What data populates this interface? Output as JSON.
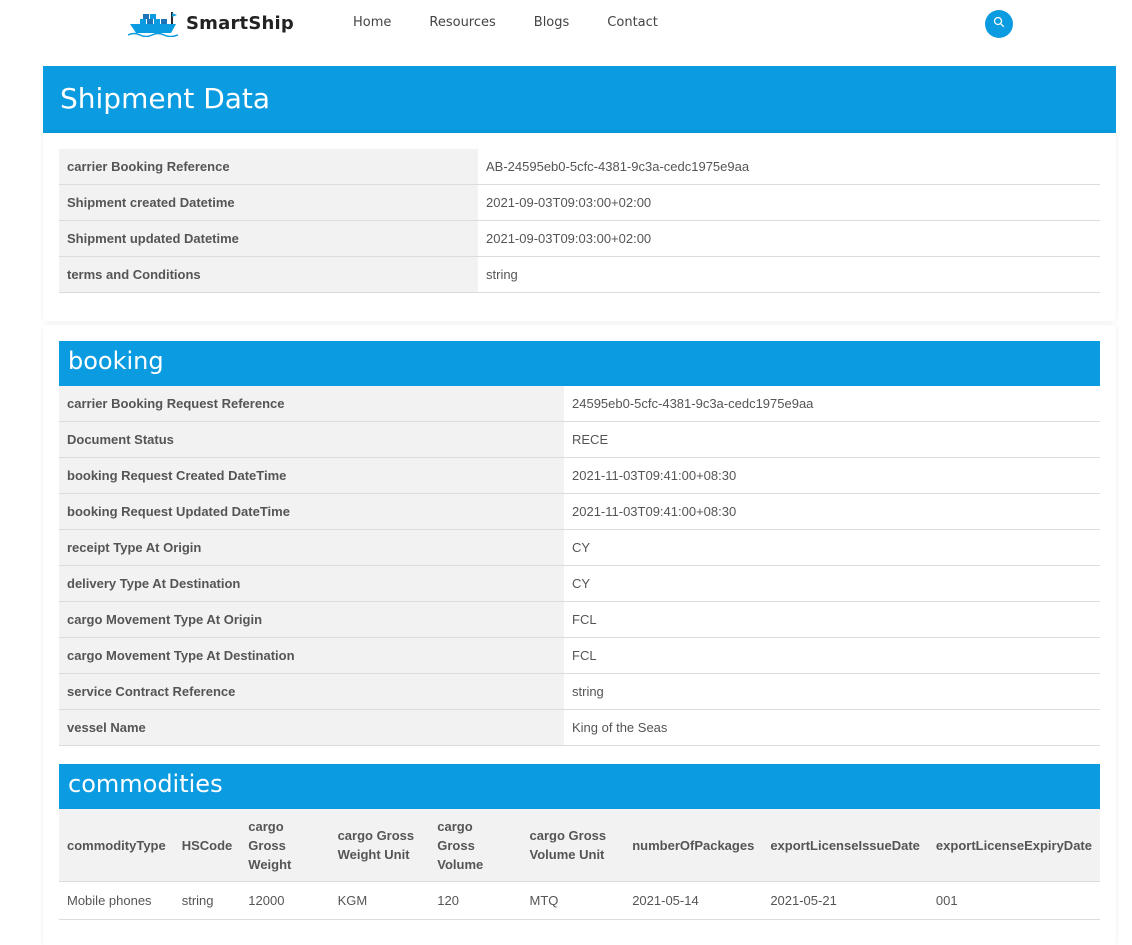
{
  "brand": {
    "name": "SmartShip",
    "logo_icon": "cargo-ship-icon"
  },
  "nav": [
    "Home",
    "Resources",
    "Blogs",
    "Contact"
  ],
  "search_icon": "search-icon",
  "colors": {
    "accent": "#0b9be0",
    "label_bg": "#f2f2f2"
  },
  "page_title": "Shipment Data",
  "shipment": [
    {
      "label": "carrier Booking Reference",
      "value": "AB-24595eb0-5cfc-4381-9c3a-cedc1975e9aa"
    },
    {
      "label": "Shipment created Datetime",
      "value": "2021-09-03T09:03:00+02:00"
    },
    {
      "label": "Shipment updated Datetime",
      "value": "2021-09-03T09:03:00+02:00"
    },
    {
      "label": "terms and Conditions",
      "value": "string"
    }
  ],
  "booking": {
    "title": "booking",
    "rows": [
      {
        "label": "carrier Booking Request Reference",
        "value": "24595eb0-5cfc-4381-9c3a-cedc1975e9aa"
      },
      {
        "label": "Document Status",
        "value": "RECE"
      },
      {
        "label": "booking Request Created DateTime",
        "value": "2021-11-03T09:41:00+08:30"
      },
      {
        "label": "booking Request Updated DateTime",
        "value": "2021-11-03T09:41:00+08:30"
      },
      {
        "label": "receipt Type At Origin",
        "value": "CY"
      },
      {
        "label": "delivery Type At Destination",
        "value": "CY"
      },
      {
        "label": "cargo Movement Type At Origin",
        "value": "FCL"
      },
      {
        "label": "cargo Movement Type At Destination",
        "value": "FCL"
      },
      {
        "label": "service Contract Reference",
        "value": "string"
      },
      {
        "label": "vessel Name",
        "value": "King of the Seas"
      }
    ]
  },
  "commodities": {
    "title": "commodities",
    "columns": [
      "commodityType",
      "HSCode",
      "cargo Gross Weight",
      "cargo Gross Weight Unit",
      "cargo Gross Volume",
      "cargo Gross Volume Unit",
      "numberOfPackages",
      "exportLicenseIssueDate",
      "exportLicenseExpiryDate"
    ],
    "rows": [
      [
        "Mobile phones",
        "string",
        "12000",
        "KGM",
        "120",
        "MTQ",
        "2021-05-14",
        "2021-05-21",
        "001"
      ]
    ]
  }
}
